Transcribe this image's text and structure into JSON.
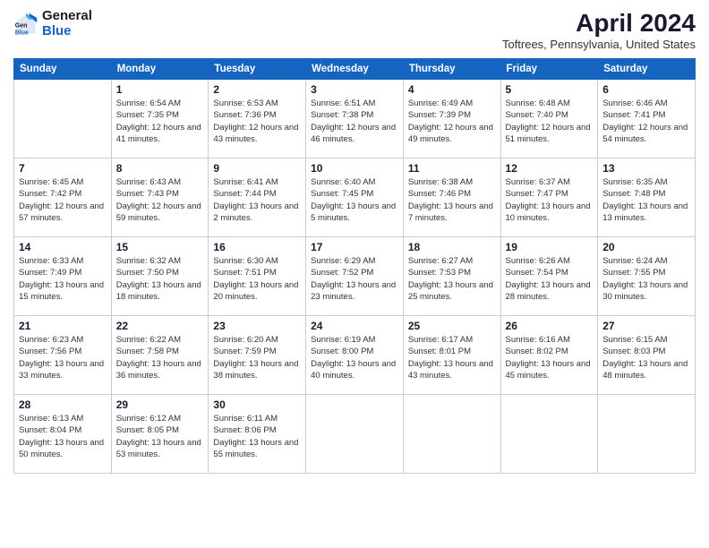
{
  "logo": {
    "line1": "General",
    "line2": "Blue"
  },
  "title": "April 2024",
  "location": "Toftrees, Pennsylvania, United States",
  "days_of_week": [
    "Sunday",
    "Monday",
    "Tuesday",
    "Wednesday",
    "Thursday",
    "Friday",
    "Saturday"
  ],
  "weeks": [
    [
      {
        "day": "",
        "sunrise": "",
        "sunset": "",
        "daylight": ""
      },
      {
        "day": "1",
        "sunrise": "Sunrise: 6:54 AM",
        "sunset": "Sunset: 7:35 PM",
        "daylight": "Daylight: 12 hours and 41 minutes."
      },
      {
        "day": "2",
        "sunrise": "Sunrise: 6:53 AM",
        "sunset": "Sunset: 7:36 PM",
        "daylight": "Daylight: 12 hours and 43 minutes."
      },
      {
        "day": "3",
        "sunrise": "Sunrise: 6:51 AM",
        "sunset": "Sunset: 7:38 PM",
        "daylight": "Daylight: 12 hours and 46 minutes."
      },
      {
        "day": "4",
        "sunrise": "Sunrise: 6:49 AM",
        "sunset": "Sunset: 7:39 PM",
        "daylight": "Daylight: 12 hours and 49 minutes."
      },
      {
        "day": "5",
        "sunrise": "Sunrise: 6:48 AM",
        "sunset": "Sunset: 7:40 PM",
        "daylight": "Daylight: 12 hours and 51 minutes."
      },
      {
        "day": "6",
        "sunrise": "Sunrise: 6:46 AM",
        "sunset": "Sunset: 7:41 PM",
        "daylight": "Daylight: 12 hours and 54 minutes."
      }
    ],
    [
      {
        "day": "7",
        "sunrise": "Sunrise: 6:45 AM",
        "sunset": "Sunset: 7:42 PM",
        "daylight": "Daylight: 12 hours and 57 minutes."
      },
      {
        "day": "8",
        "sunrise": "Sunrise: 6:43 AM",
        "sunset": "Sunset: 7:43 PM",
        "daylight": "Daylight: 12 hours and 59 minutes."
      },
      {
        "day": "9",
        "sunrise": "Sunrise: 6:41 AM",
        "sunset": "Sunset: 7:44 PM",
        "daylight": "Daylight: 13 hours and 2 minutes."
      },
      {
        "day": "10",
        "sunrise": "Sunrise: 6:40 AM",
        "sunset": "Sunset: 7:45 PM",
        "daylight": "Daylight: 13 hours and 5 minutes."
      },
      {
        "day": "11",
        "sunrise": "Sunrise: 6:38 AM",
        "sunset": "Sunset: 7:46 PM",
        "daylight": "Daylight: 13 hours and 7 minutes."
      },
      {
        "day": "12",
        "sunrise": "Sunrise: 6:37 AM",
        "sunset": "Sunset: 7:47 PM",
        "daylight": "Daylight: 13 hours and 10 minutes."
      },
      {
        "day": "13",
        "sunrise": "Sunrise: 6:35 AM",
        "sunset": "Sunset: 7:48 PM",
        "daylight": "Daylight: 13 hours and 13 minutes."
      }
    ],
    [
      {
        "day": "14",
        "sunrise": "Sunrise: 6:33 AM",
        "sunset": "Sunset: 7:49 PM",
        "daylight": "Daylight: 13 hours and 15 minutes."
      },
      {
        "day": "15",
        "sunrise": "Sunrise: 6:32 AM",
        "sunset": "Sunset: 7:50 PM",
        "daylight": "Daylight: 13 hours and 18 minutes."
      },
      {
        "day": "16",
        "sunrise": "Sunrise: 6:30 AM",
        "sunset": "Sunset: 7:51 PM",
        "daylight": "Daylight: 13 hours and 20 minutes."
      },
      {
        "day": "17",
        "sunrise": "Sunrise: 6:29 AM",
        "sunset": "Sunset: 7:52 PM",
        "daylight": "Daylight: 13 hours and 23 minutes."
      },
      {
        "day": "18",
        "sunrise": "Sunrise: 6:27 AM",
        "sunset": "Sunset: 7:53 PM",
        "daylight": "Daylight: 13 hours and 25 minutes."
      },
      {
        "day": "19",
        "sunrise": "Sunrise: 6:26 AM",
        "sunset": "Sunset: 7:54 PM",
        "daylight": "Daylight: 13 hours and 28 minutes."
      },
      {
        "day": "20",
        "sunrise": "Sunrise: 6:24 AM",
        "sunset": "Sunset: 7:55 PM",
        "daylight": "Daylight: 13 hours and 30 minutes."
      }
    ],
    [
      {
        "day": "21",
        "sunrise": "Sunrise: 6:23 AM",
        "sunset": "Sunset: 7:56 PM",
        "daylight": "Daylight: 13 hours and 33 minutes."
      },
      {
        "day": "22",
        "sunrise": "Sunrise: 6:22 AM",
        "sunset": "Sunset: 7:58 PM",
        "daylight": "Daylight: 13 hours and 36 minutes."
      },
      {
        "day": "23",
        "sunrise": "Sunrise: 6:20 AM",
        "sunset": "Sunset: 7:59 PM",
        "daylight": "Daylight: 13 hours and 38 minutes."
      },
      {
        "day": "24",
        "sunrise": "Sunrise: 6:19 AM",
        "sunset": "Sunset: 8:00 PM",
        "daylight": "Daylight: 13 hours and 40 minutes."
      },
      {
        "day": "25",
        "sunrise": "Sunrise: 6:17 AM",
        "sunset": "Sunset: 8:01 PM",
        "daylight": "Daylight: 13 hours and 43 minutes."
      },
      {
        "day": "26",
        "sunrise": "Sunrise: 6:16 AM",
        "sunset": "Sunset: 8:02 PM",
        "daylight": "Daylight: 13 hours and 45 minutes."
      },
      {
        "day": "27",
        "sunrise": "Sunrise: 6:15 AM",
        "sunset": "Sunset: 8:03 PM",
        "daylight": "Daylight: 13 hours and 48 minutes."
      }
    ],
    [
      {
        "day": "28",
        "sunrise": "Sunrise: 6:13 AM",
        "sunset": "Sunset: 8:04 PM",
        "daylight": "Daylight: 13 hours and 50 minutes."
      },
      {
        "day": "29",
        "sunrise": "Sunrise: 6:12 AM",
        "sunset": "Sunset: 8:05 PM",
        "daylight": "Daylight: 13 hours and 53 minutes."
      },
      {
        "day": "30",
        "sunrise": "Sunrise: 6:11 AM",
        "sunset": "Sunset: 8:06 PM",
        "daylight": "Daylight: 13 hours and 55 minutes."
      },
      {
        "day": "",
        "sunrise": "",
        "sunset": "",
        "daylight": ""
      },
      {
        "day": "",
        "sunrise": "",
        "sunset": "",
        "daylight": ""
      },
      {
        "day": "",
        "sunrise": "",
        "sunset": "",
        "daylight": ""
      },
      {
        "day": "",
        "sunrise": "",
        "sunset": "",
        "daylight": ""
      }
    ]
  ]
}
